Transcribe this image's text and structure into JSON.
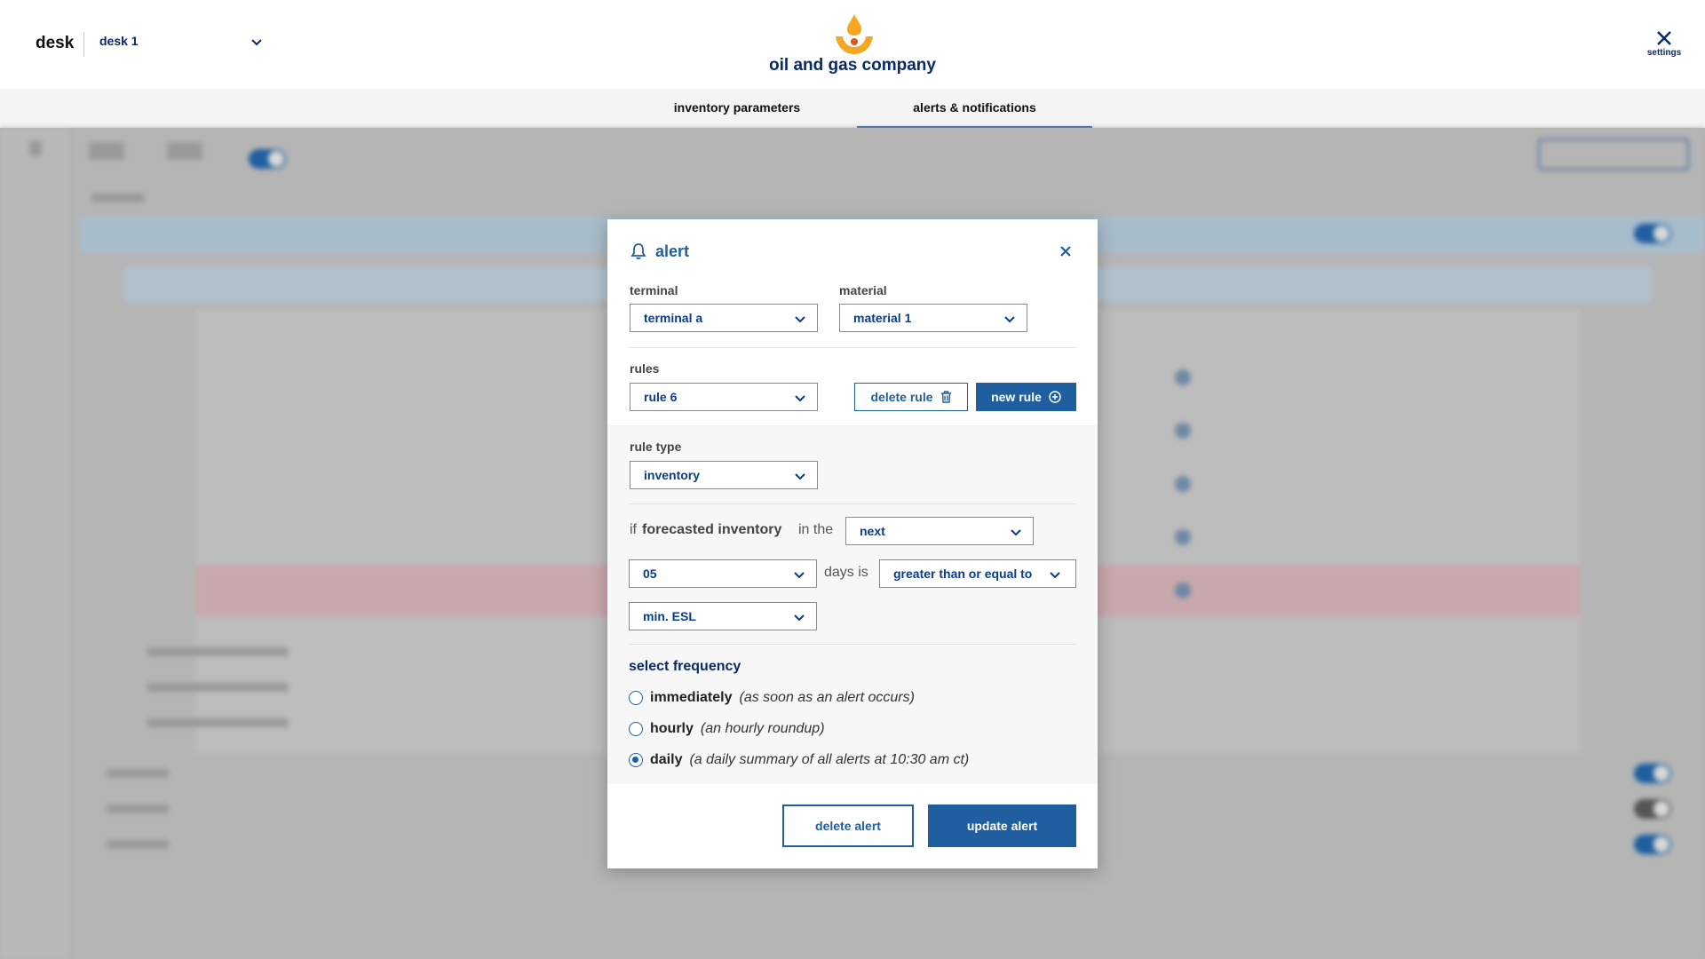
{
  "header": {
    "desk_label": "desk",
    "desk_selected": "desk 1",
    "company_name": "oil and gas company",
    "settings_label": "settings"
  },
  "tabs": [
    {
      "label": "inventory parameters",
      "active": false
    },
    {
      "label": "alerts & notifications",
      "active": true
    }
  ],
  "modal": {
    "title": "alert",
    "terminal_label": "terminal",
    "terminal_value": "terminal a",
    "material_label": "material",
    "material_value": "material 1",
    "rules_label": "rules",
    "rules_value": "rule 6",
    "delete_rule_label": "delete rule",
    "new_rule_label": "new rule",
    "rule_type_label": "rule type",
    "rule_type_value": "inventory",
    "condition": {
      "prefix": "if",
      "subject": "forecasted inventory",
      "in_the": "in the",
      "period_value": "next",
      "days_value": "05",
      "days_is": "days is",
      "comparison_value": "greater than or equal to",
      "threshold_value": "min. ESL"
    },
    "frequency_title": "select frequency",
    "frequencies": [
      {
        "name": "immediately",
        "desc": "(as soon as an alert occurs)",
        "checked": false
      },
      {
        "name": "hourly",
        "desc": "(an hourly roundup)",
        "checked": false
      },
      {
        "name": "daily",
        "desc": "(a daily summary of all alerts at 10:30 am ct)",
        "checked": true
      }
    ],
    "delete_alert_label": "delete alert",
    "update_alert_label": "update alert"
  },
  "colors": {
    "primary": "#1f5fa0",
    "navy": "#0a2a66",
    "logo_orange": "#f5a623",
    "overlay": "#b3b3b3"
  }
}
